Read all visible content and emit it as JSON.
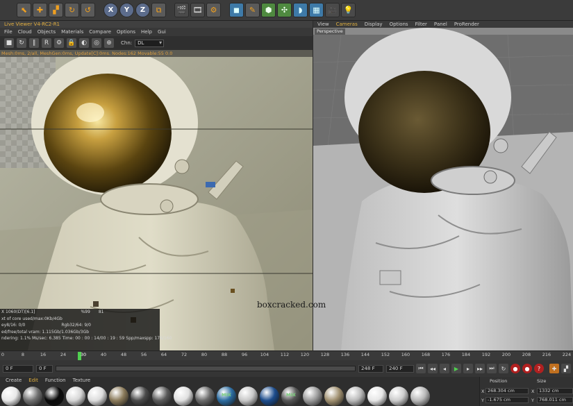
{
  "toolbar": {
    "buttons": [
      {
        "name": "select-icon",
        "glyph": "⬉",
        "style": "hot"
      },
      {
        "name": "move-icon",
        "glyph": "✚",
        "style": "hot"
      },
      {
        "name": "scale-icon",
        "glyph": "▞",
        "style": "hot"
      },
      {
        "name": "rotate-icon",
        "glyph": "↻",
        "style": "hot"
      },
      {
        "name": "rotate-alt-icon",
        "glyph": "↺",
        "style": "hot"
      },
      {
        "name": "gap",
        "glyph": "",
        "style": "gap"
      },
      {
        "name": "x-axis-icon",
        "glyph": "X",
        "style": "axis"
      },
      {
        "name": "y-axis-icon",
        "glyph": "Y",
        "style": "axis"
      },
      {
        "name": "z-axis-icon",
        "glyph": "Z",
        "style": "axis"
      },
      {
        "name": "coordinate-system-icon",
        "glyph": "⧉",
        "style": "hot"
      },
      {
        "name": "gap",
        "glyph": "",
        "style": "gap"
      },
      {
        "name": "render-view-icon",
        "glyph": "🎬",
        "style": ""
      },
      {
        "name": "render-picture-icon",
        "glyph": "🎞",
        "style": ""
      },
      {
        "name": "render-settings-icon",
        "glyph": "⚙",
        "style": "hot"
      },
      {
        "name": "gap",
        "glyph": "",
        "style": "gap"
      },
      {
        "name": "cube-icon",
        "glyph": "◼",
        "style": "cyan"
      },
      {
        "name": "pen-icon",
        "glyph": "✎",
        "style": "hot"
      },
      {
        "name": "subdivision-icon",
        "glyph": "⬢",
        "style": "green"
      },
      {
        "name": "array-icon",
        "glyph": "✣",
        "style": "green"
      },
      {
        "name": "deformer-icon",
        "glyph": "◗",
        "style": "cyan"
      },
      {
        "name": "floor-icon",
        "glyph": "▦",
        "style": "cyan"
      },
      {
        "name": "camera-icon",
        "glyph": "🎥",
        "style": ""
      },
      {
        "name": "light-icon",
        "glyph": "💡",
        "style": ""
      }
    ]
  },
  "live_viewer": {
    "title": "Live Viewer V4-RC2-R1",
    "menu": [
      "File",
      "Cloud",
      "Objects",
      "Materials",
      "Compare",
      "Options",
      "Help",
      "Gui"
    ],
    "icons": [
      {
        "name": "stop-icon",
        "glyph": "■"
      },
      {
        "name": "restart-icon",
        "glyph": "↻"
      },
      {
        "name": "pause-icon",
        "glyph": "∥"
      },
      {
        "name": "region-icon",
        "glyph": "R"
      },
      {
        "name": "settings-icon",
        "glyph": "⚙"
      },
      {
        "name": "lock-icon",
        "glyph": "🔒"
      },
      {
        "name": "clay-icon",
        "glyph": "◐"
      },
      {
        "name": "pick-icon",
        "glyph": "◎"
      },
      {
        "name": "focus-icon",
        "glyph": "⊕"
      }
    ],
    "channel_label": "Chn:",
    "channel_value": "DL",
    "status": "Mesh:0ms, 2/all, MeshGen:0ms, Update[C]:0ms. Nodes:162 Movable:55  0.0",
    "stats": {
      "gpu": "X 1060(DT)[6.1]",
      "gpu_pct": "%99",
      "gpu_val": "81",
      "core": "xt of core used/max:0Kb/4Gb",
      "rgb_left": "ey8/16: 0/0",
      "rgb_right": "Rgb32/64: 9/0",
      "vram": "ed/free/total vram: 1.115Gb/1.036Gb/3Gb",
      "render": "ndering: 1.1%   Ms/sec: 6.385   Time: 00 : 00 : 14/00 : 19 : 59   Spp/maxspp: 176/160"
    }
  },
  "editor": {
    "menu": [
      "View",
      "Cameras",
      "Display",
      "Options",
      "Filter",
      "Panel",
      "ProRender"
    ],
    "active_menu": "Cameras",
    "camera_label": "Perspective"
  },
  "watermark": "boxcracked.com",
  "timeline": {
    "ticks": [
      "0",
      "8",
      "16",
      "24",
      "30",
      "40",
      "48",
      "56",
      "64",
      "72",
      "80",
      "88",
      "96",
      "104",
      "112",
      "120",
      "128",
      "136",
      "144",
      "152",
      "160",
      "168",
      "176",
      "184",
      "192",
      "200",
      "208",
      "216",
      "224"
    ],
    "current_frame": "30"
  },
  "playback": {
    "start": "0 F",
    "current": "0 F",
    "end_min": "248 F",
    "end": "240 F"
  },
  "materials": {
    "menu": [
      "Create",
      "Edit",
      "Function",
      "Texture"
    ],
    "active_menu": "Edit",
    "swatches": [
      {
        "color": "#e8e8e8",
        "label": ""
      },
      {
        "color": "#707070",
        "label": ""
      },
      {
        "color": "#0a0a0a",
        "label": ""
      },
      {
        "color": "#d6d6d6",
        "label": ""
      },
      {
        "color": "#dcdcdc",
        "label": ""
      },
      {
        "color": "#8a7a5a",
        "label": ""
      },
      {
        "color": "#4a4a4a",
        "label": ""
      },
      {
        "color": "#5a5a5a",
        "label": ""
      },
      {
        "color": "#e0e0e0",
        "label": ""
      },
      {
        "color": "#6a6a6a",
        "label": ""
      },
      {
        "color": "#2c6ca0",
        "label": "MIX"
      },
      {
        "color": "#c8c8c8",
        "label": ""
      },
      {
        "color": "#1c4c8c",
        "label": ""
      },
      {
        "color": "#555555",
        "label": "MIX"
      },
      {
        "color": "#9a9a9a",
        "label": ""
      },
      {
        "color": "#a09070",
        "label": ""
      },
      {
        "color": "#bababa",
        "label": ""
      },
      {
        "color": "#e6e6e6",
        "label": ""
      },
      {
        "color": "#cccccc",
        "label": ""
      },
      {
        "color": "#b8b8b8",
        "label": ""
      }
    ]
  },
  "coordinates": {
    "position_label": "Position",
    "size_label": "Size",
    "rows": [
      {
        "axis": "X",
        "position": "268.304 cm",
        "size": "1332 cm"
      },
      {
        "axis": "Y",
        "position": "-1.675 cm",
        "size": "768.011 cm"
      }
    ]
  },
  "colors": {
    "accent": "#e0b040",
    "play_green": "#50d050",
    "record_red": "#b02020"
  }
}
